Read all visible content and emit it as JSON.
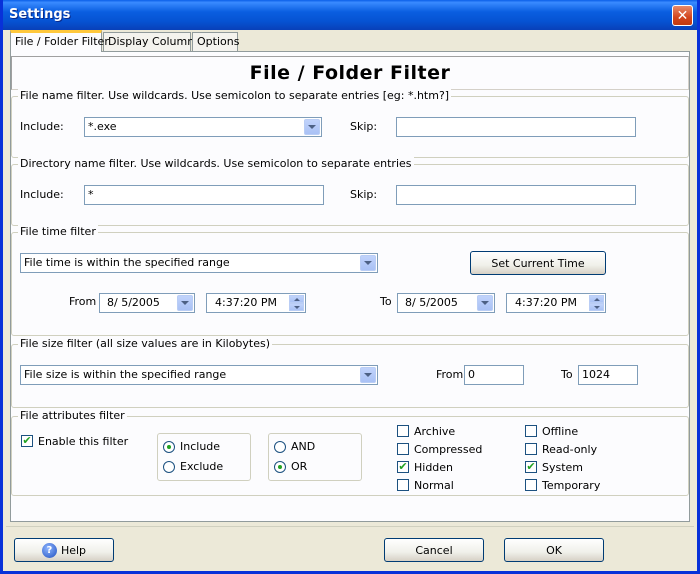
{
  "window": {
    "title": "Settings",
    "close": "✕"
  },
  "tabs": [
    "File / Folder Filter",
    "Display Columns",
    "Options"
  ],
  "header": "File / Folder Filter",
  "file_name_filter": {
    "legend": "File name filter. Use wildcards. Use semicolon to separate entries [eg: *.htm?]",
    "include_label": "Include:",
    "include_value": "*.exe",
    "skip_label": "Skip:",
    "skip_value": ""
  },
  "dir_name_filter": {
    "legend": "Directory name filter. Use wildcards. Use semicolon to separate entries",
    "include_label": "Include:",
    "include_value": "*",
    "skip_label": "Skip:",
    "skip_value": ""
  },
  "file_time_filter": {
    "legend": "File time filter",
    "mode": "File time is within the specified range",
    "set_current_button": "Set Current Time",
    "from_label": "From",
    "from_date": "8/ 5/2005",
    "from_time": "4:37:20 PM",
    "to_label": "To",
    "to_date": "8/ 5/2005",
    "to_time": "4:37:20 PM"
  },
  "file_size_filter": {
    "legend": "File size filter (all size values are in Kilobytes)",
    "mode": "File size is within the specified range",
    "from_label": "From",
    "from_value": "0",
    "to_label": "To",
    "to_value": "1024"
  },
  "attributes_filter": {
    "legend": "File attributes filter",
    "enable_label": "Enable this filter",
    "enable_checked": true,
    "include_label": "Include",
    "exclude_label": "Exclude",
    "include_selected": true,
    "and_label": "AND",
    "or_label": "OR",
    "or_selected": true,
    "attributes": [
      {
        "label": "Archive",
        "checked": false
      },
      {
        "label": "Compressed",
        "checked": false
      },
      {
        "label": "Hidden",
        "checked": true
      },
      {
        "label": "Normal",
        "checked": false
      },
      {
        "label": "Offline",
        "checked": false
      },
      {
        "label": "Read-only",
        "checked": false
      },
      {
        "label": "System",
        "checked": true
      },
      {
        "label": "Temporary",
        "checked": false
      }
    ]
  },
  "buttons": {
    "help": "Help",
    "cancel": "Cancel",
    "ok": "OK"
  },
  "icons": {
    "check_mark": "✔",
    "help_icon": "?"
  }
}
